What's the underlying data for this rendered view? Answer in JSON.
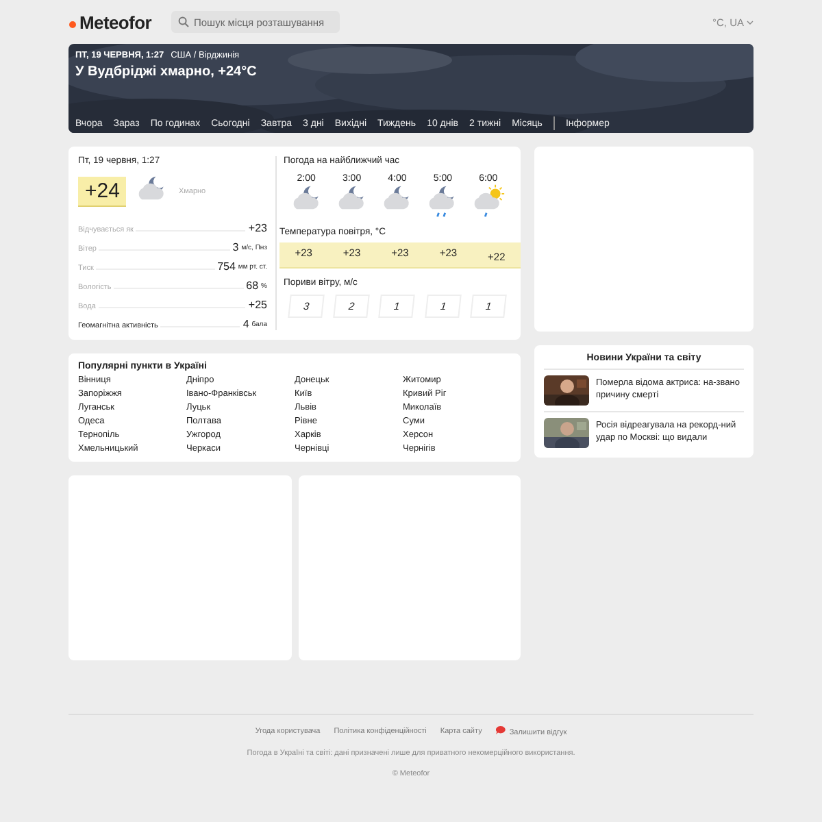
{
  "header": {
    "logo": "Meteofor",
    "search": {
      "placeholder": "Пошук місця розташування"
    },
    "units": "°C, UA"
  },
  "hero": {
    "date": "ПТ, 19 ЧЕРВНЯ, 1:27",
    "location": "США / Вірджинія",
    "headline": "У Вудбріджі хмарно, +24°C",
    "nav": [
      {
        "label": "Вчора",
        "kind": "link"
      },
      {
        "label": "Зараз",
        "kind": "link"
      },
      {
        "label": "По годинах",
        "kind": "link"
      },
      {
        "label": "Сьогодні",
        "kind": "link"
      },
      {
        "label": "Завтра",
        "kind": "link"
      },
      {
        "label": "3 дні",
        "kind": "link"
      },
      {
        "label": "Вихідні",
        "kind": "link"
      },
      {
        "label": "Тиждень",
        "kind": "link"
      },
      {
        "label": "10 днів",
        "kind": "link"
      },
      {
        "label": "2 тижні",
        "kind": "link"
      },
      {
        "label": "Місяць",
        "kind": "link"
      },
      {
        "label": "Інформер",
        "kind": "separated"
      }
    ]
  },
  "now": {
    "date": "Пт, 19 червня, 1:27",
    "temp": "+24",
    "condition": "Хмарно",
    "details": [
      {
        "label": "Відчувається як",
        "value": "+23"
      },
      {
        "label": "Вітер",
        "value": "3",
        "unit": "м/с, Пнз"
      },
      {
        "label": "Тиск",
        "value": "754",
        "unit": "мм рт. ст."
      },
      {
        "label": "Вологість",
        "value": "68",
        "unit": "%"
      },
      {
        "label": "Вода",
        "value": "+25"
      },
      {
        "label": "Геомагнітна активність",
        "value": "4",
        "unit": "бала"
      }
    ]
  },
  "hourly": {
    "title": "Погода на найближчий час",
    "temp_title": "Температура повітря, °C",
    "gust_title": "Пориви вітру, м/с",
    "hours": [
      {
        "time": "2:00",
        "kind": "night",
        "temp": "+23",
        "gust": "3"
      },
      {
        "time": "3:00",
        "kind": "night",
        "temp": "+23",
        "gust": "2"
      },
      {
        "time": "4:00",
        "kind": "night",
        "temp": "+23",
        "gust": "1"
      },
      {
        "time": "5:00",
        "kind": "night-rain",
        "temp": "+23",
        "gust": "1"
      },
      {
        "time": "6:00",
        "kind": "day-rain",
        "temp": "+22",
        "gust": "1"
      }
    ]
  },
  "popular": {
    "title": "Популярні пункти в Україні",
    "cities": [
      "Вінниця",
      "Дніпро",
      "Донецьк",
      "Житомир",
      "Запоріжжя",
      "Івано-Франківськ",
      "Київ",
      "Кривий Ріг",
      "Луганськ",
      "Луцьк",
      "Львів",
      "Миколаїв",
      "Одеса",
      "Полтава",
      "Рівне",
      "Суми",
      "Тернопіль",
      "Ужгород",
      "Харків",
      "Херсон",
      "Хмельницький",
      "Черкаси",
      "Чернівці",
      "Чернігів"
    ]
  },
  "news": {
    "title": "Новини України та світу",
    "items": [
      {
        "text": "Померла відома актриса: на-звано причину смерті",
        "kind": "picture"
      },
      {
        "text": "Росія відреагувала на рекорд-ний удар по Москві: що видали",
        "kind": "picture"
      }
    ]
  },
  "footer": {
    "links": [
      "Угода користувача",
      "Політика конфіденційності",
      "Карта сайту",
      "Залишити відгук"
    ],
    "note": "Погода в Україні та світі: дані призначені лише для приватного некомерційного використання.",
    "copyright": "© Meteofor"
  }
}
